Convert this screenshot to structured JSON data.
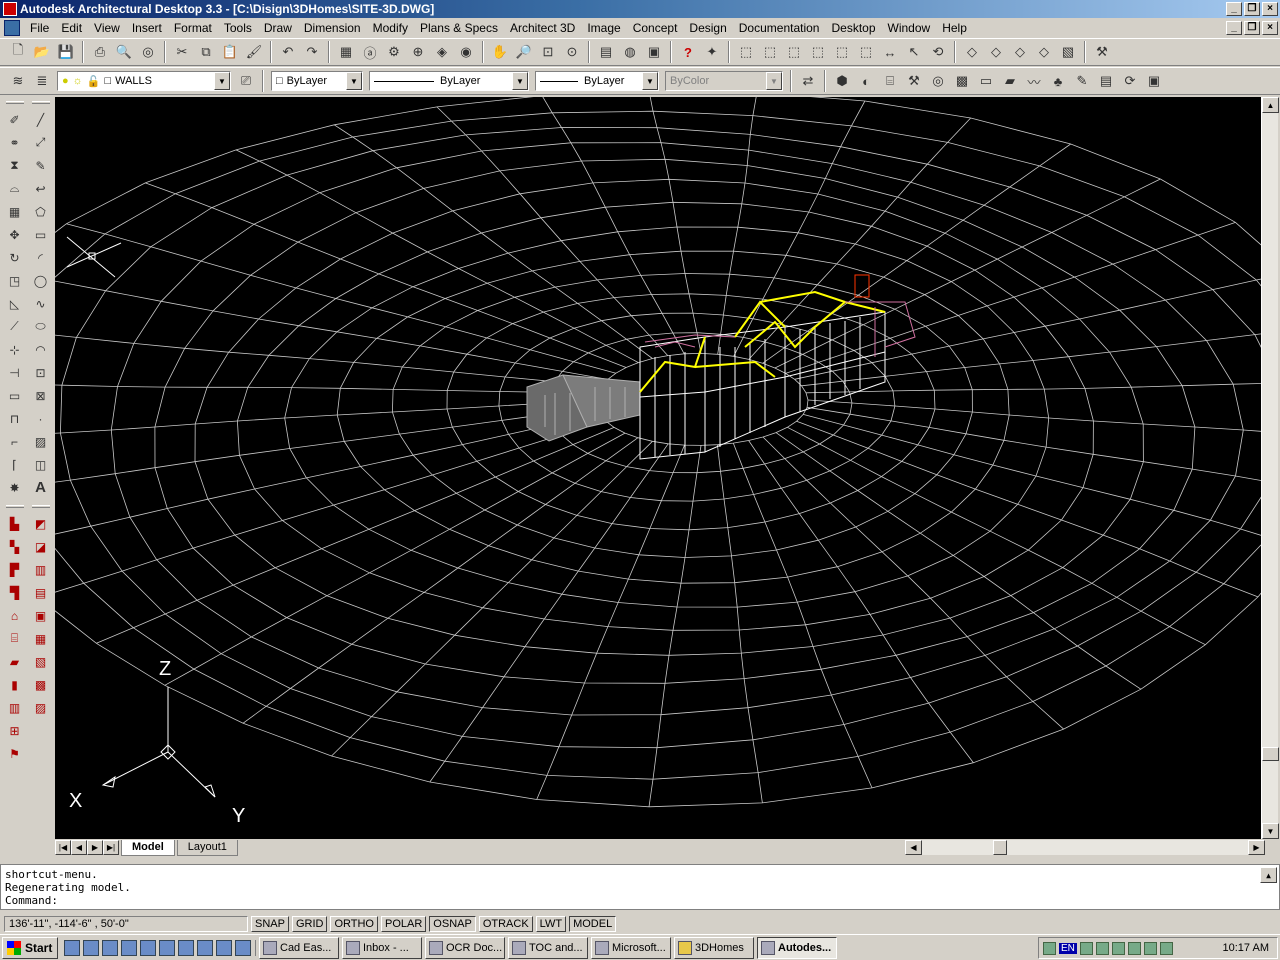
{
  "window": {
    "title": "Autodesk Architectural Desktop 3.3 - [C:\\Disign\\3DHomes\\SITE-3D.DWG]"
  },
  "menu": [
    "File",
    "Edit",
    "View",
    "Insert",
    "Format",
    "Tools",
    "Draw",
    "Dimension",
    "Modify",
    "Plans & Specs",
    "Architect 3D",
    "Image",
    "Concept",
    "Design",
    "Documentation",
    "Desktop",
    "Window",
    "Help"
  ],
  "layer_bar": {
    "layer": "WALLS",
    "color": "ByLayer",
    "linetype": "ByLayer",
    "lineweight": "ByLayer",
    "plotstyle": "ByColor"
  },
  "viewport": {
    "ucs_x": "X",
    "ucs_y": "Y",
    "ucs_z": "Z",
    "colors": {
      "mesh": "#c8c8c8",
      "house": "#ffffff",
      "roof": "#ffff00",
      "accent": "#d070a0",
      "chimney": "#ff3300"
    }
  },
  "tabs": {
    "model": "Model",
    "layout": "Layout1"
  },
  "command": {
    "line1": "shortcut-menu.",
    "line2": "Regenerating model.",
    "prompt": "Command:"
  },
  "status": {
    "coords": "136'-11\",   -114'-6\"  , 50'-0\"",
    "buttons": [
      "SNAP",
      "GRID",
      "ORTHO",
      "POLAR",
      "OSNAP",
      "OTRACK",
      "LWT",
      "MODEL"
    ]
  },
  "taskbar": {
    "start": "Start",
    "tasks": [
      "Cad Eas...",
      "Inbox - ...",
      "OCR Doc...",
      "TOC and...",
      "Microsoft...",
      "3DHomes",
      "Autodes..."
    ],
    "lang": "EN",
    "clock": "10:17 AM"
  }
}
